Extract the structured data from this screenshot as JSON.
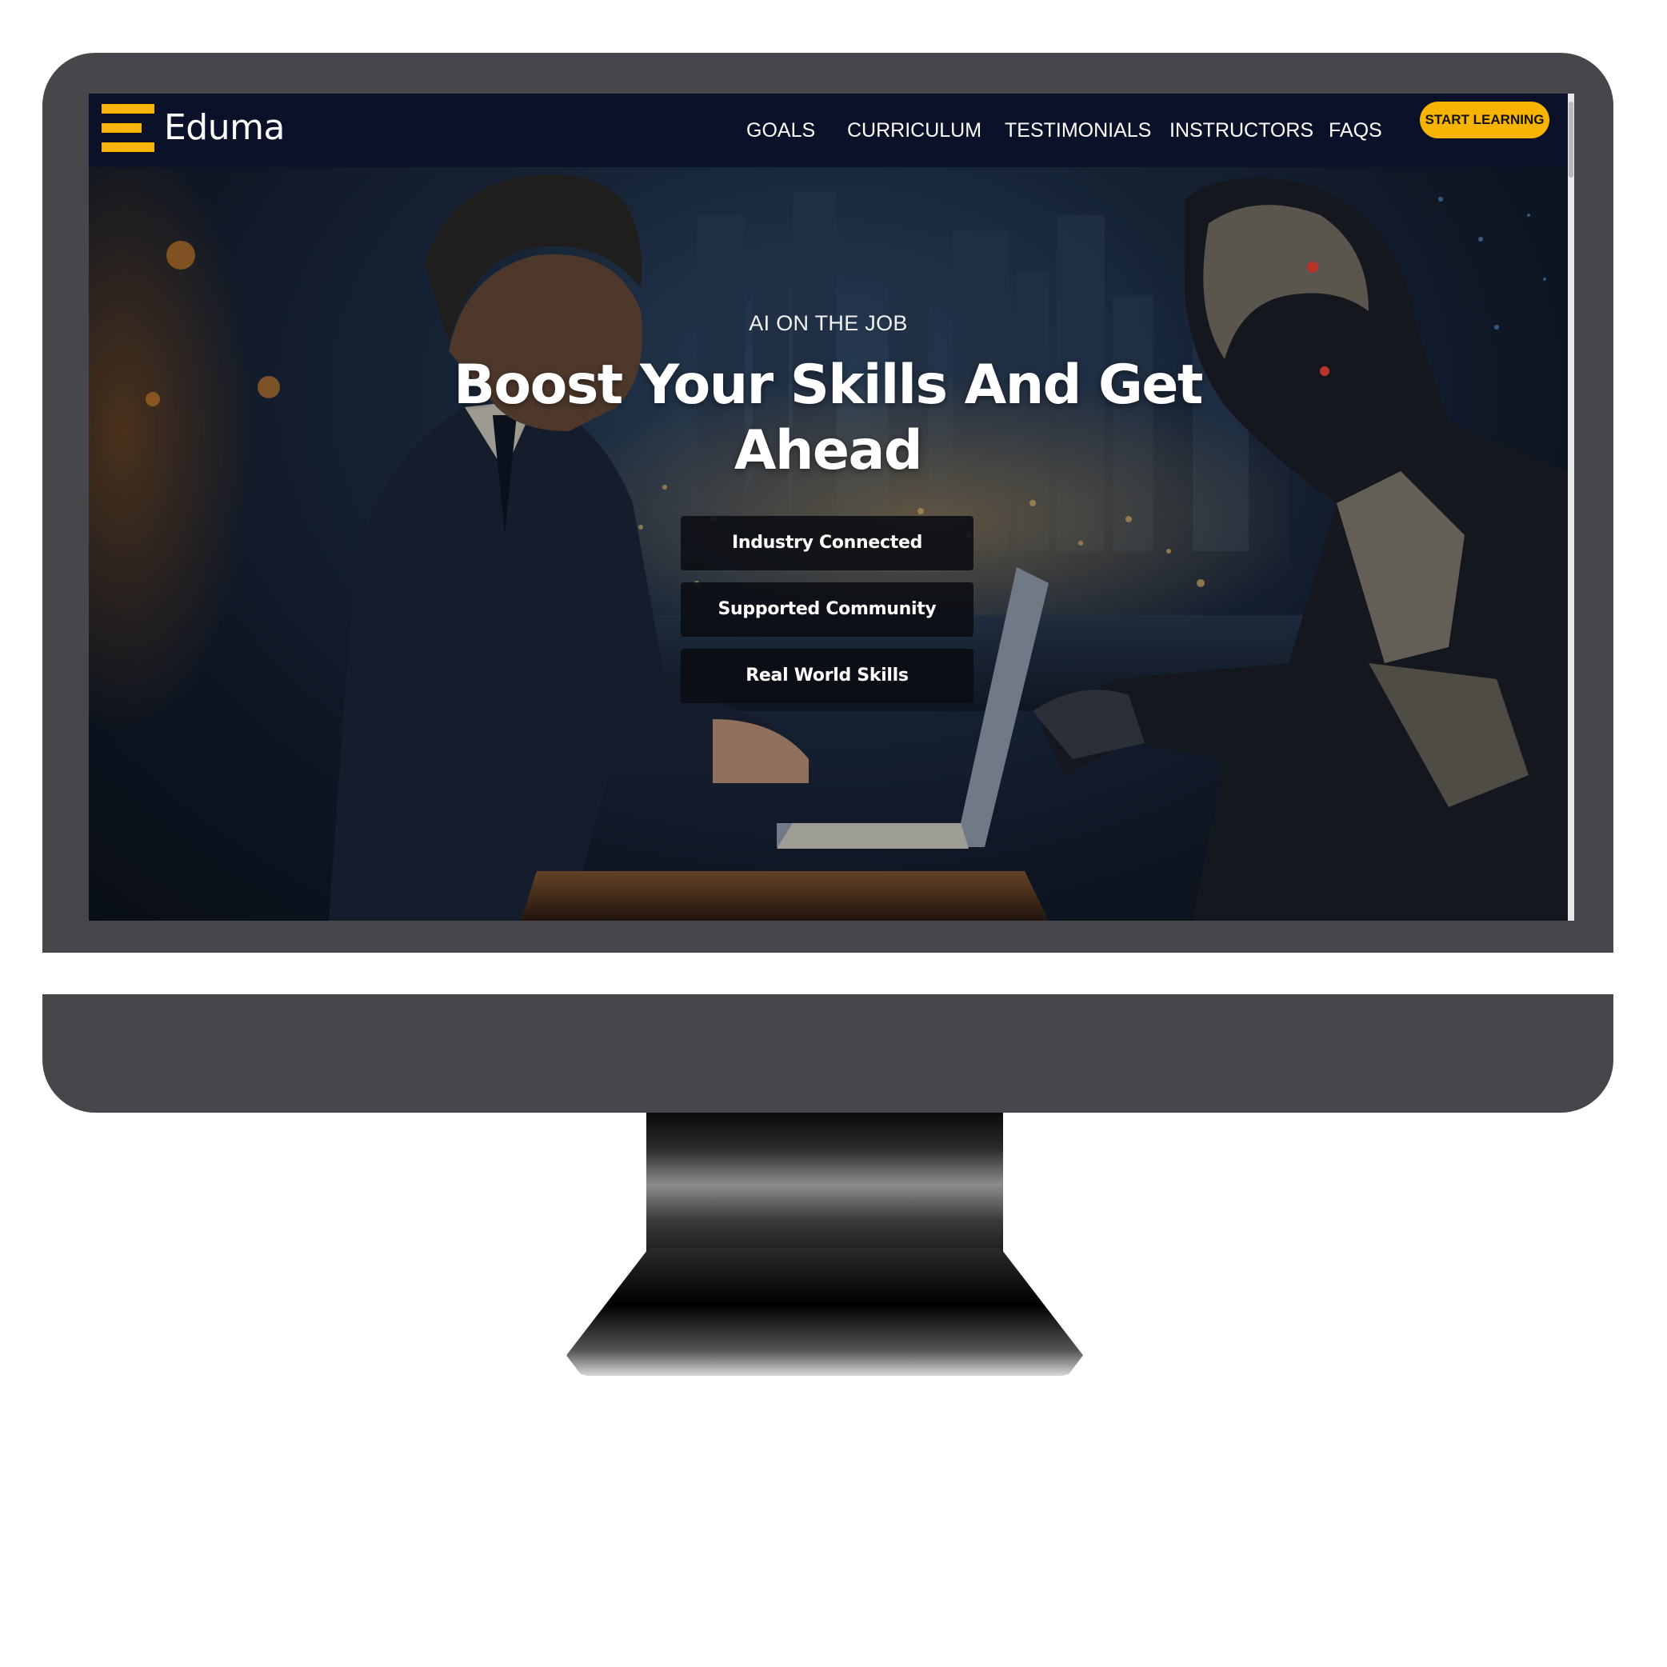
{
  "brand": {
    "name": "Eduma",
    "accent_color": "#f6b300",
    "nav_background": "#0b1129"
  },
  "nav": {
    "links": [
      "GOALS",
      "CURRICULUM",
      "TESTIMONIALS",
      "INSTRUCTORS",
      "FAQS"
    ],
    "cta_label": "START LEARNING"
  },
  "hero": {
    "eyebrow": "AI ON THE JOB",
    "headline": "Boost Your Skills And Get Ahead",
    "features": [
      "Industry Connected",
      "Supported Community",
      "Real World Skills"
    ],
    "illustration": "businessman-with-laptop-facing-robot-night-city"
  }
}
